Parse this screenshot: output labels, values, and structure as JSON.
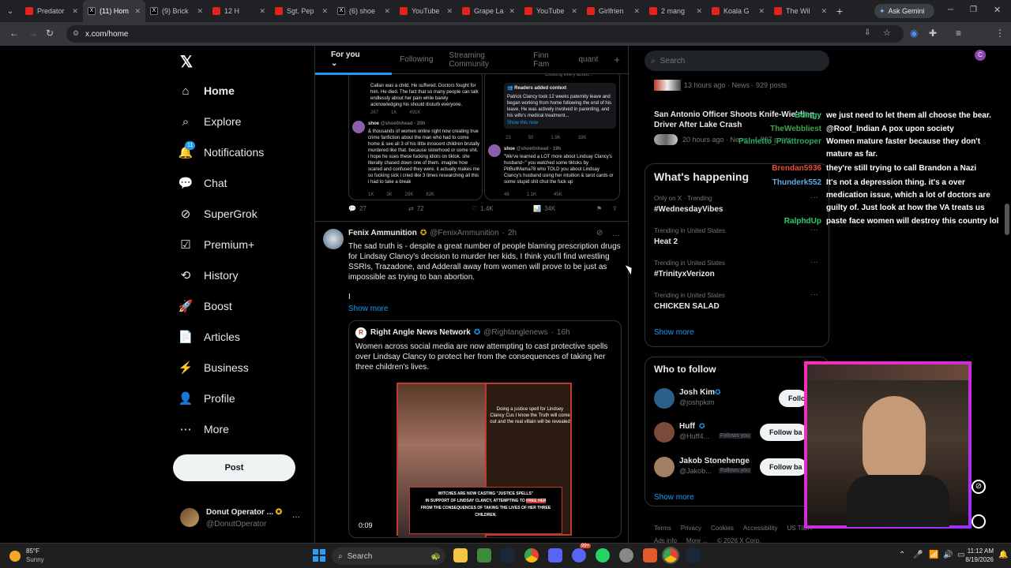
{
  "browser": {
    "tabs": [
      {
        "title": "Predator",
        "icon": "yt"
      },
      {
        "title": "(11) Hom",
        "icon": "x",
        "active": true
      },
      {
        "title": "(9) Brick",
        "icon": "x"
      },
      {
        "title": "12 H",
        "icon": "yt"
      },
      {
        "title": "Sgt. Pep",
        "icon": "yt"
      },
      {
        "title": "(6) shoe",
        "icon": "x"
      },
      {
        "title": "YouTube",
        "icon": "yt"
      },
      {
        "title": "Grape La",
        "icon": "yt"
      },
      {
        "title": "YouTube",
        "icon": "yt"
      },
      {
        "title": "Girlfrien",
        "icon": "yt"
      },
      {
        "title": "2 mang",
        "icon": "yt"
      },
      {
        "title": "Koala G",
        "icon": "yt"
      },
      {
        "title": "The Wil",
        "icon": "yt"
      }
    ],
    "ask_gemini": "Ask Gemini",
    "url": "x.com/home",
    "profile_initial": "C"
  },
  "nav": {
    "items": [
      "Home",
      "Explore",
      "Notifications",
      "Chat",
      "SuperGrok",
      "Premium+",
      "History",
      "Boost",
      "Articles",
      "Business",
      "Profile",
      "More"
    ],
    "notif_badge": "11",
    "post_button": "Post",
    "account_name": "Donut Operator ...",
    "account_handle": "@DonutOperator"
  },
  "feed": {
    "tabs": [
      "For you",
      "Following",
      "Streaming Community",
      "Finn Fam",
      "quant"
    ],
    "prev_left_text": "Callan was a child. He suffered. Doctors fought for him. He died. The fact that so many people can talk endlessly about her pain while barely acknowledging his should disturb everyone.",
    "prev_left_stats": [
      "267",
      "1K",
      "491K"
    ],
    "prev_left_user": "shoe",
    "prev_left_handle": "@shoe0nhead · 20h",
    "prev_left_body": "& thousands of women online right now creating true crime fanfiction about the man who had to come home & see all 3 of his little innocent children brutally murdered like that. because sisterhood or some shit. i hope he sues these fucking idiots on tiktok. she literally chased down one of them. imagine how scared and confused they were. it actually makes me so fucking sick i cried like 3 times researching all this i had to take a break",
    "prev_left_stats2": [
      "1K",
      "3K",
      "29K",
      "82K"
    ],
    "prev_right_top": "Cooking every about...",
    "readers_title": "Readers added context",
    "readers_body": "Patrick Clancy took 12 weeks paternity leave and began working from home following the end of his leave. He was actively involved in parenting, and his wife's medical treatment...",
    "readers_link": "Show this note",
    "prev_right_stats": [
      "23",
      "50",
      "1.9K",
      "33K"
    ],
    "prev_right_user": "shoe",
    "prev_right_handle": "@shoe0nhead · 19h",
    "prev_right_body": "\"We've learned a LOT more about Lindsay Clancy's husband~\" you watched some tiktoks by PitBullMama78 who TOLD you about Lindsay Clancy's husband using her intuition & tarot cards or some stupid shit chut the fuck up",
    "prev_right_stats2": [
      "48",
      "1.1K",
      "45K"
    ],
    "prev_actions": [
      "27",
      "72",
      "1.4K",
      "34K"
    ],
    "post": {
      "name": "Fenix Ammunition",
      "handle": "@FenixAmmunition",
      "time": "2h",
      "text": "The sad truth is - despite a great number of people blaming prescription drugs for Lindsay Clancy's decision to murder her kids, I think you'll find wrestling SSRIs, Trazadone, and Adderall away from women will prove to be just as impossible as trying to ban abortion.",
      "cursor_char": "I",
      "show_more": "Show more",
      "quote_name": "Right Angle News Network",
      "quote_handle": "@Rightanglenews",
      "quote_time": "16h",
      "quote_text": "Women across social media are now attempting to cast protective spells over Lindsay Clancy to protect her from the consequences of taking her three children's lives.",
      "img_caption": "Doing a justice spell for Lindsey Clancy Cus I know the Truth will come out and the real villain will be revealed",
      "img_banner_1": "WITCHES ARE NOW CASTING \"JUSTICE SPELLS\"",
      "img_banner_2": "IN SUPPORT OF LINDSAY CLANCY, ATTEMPTING TO",
      "img_banner_free": "FREE HER",
      "img_banner_3": "FROM THE CONSEQUENCES OF TAKING THE LIVES OF HER THREE CHILDREN.",
      "video_time": "0:09"
    }
  },
  "sidebar": {
    "search_placeholder": "Search",
    "news1_meta": "13 hours ago · News · 929 posts",
    "news2_title": "San Antonio Officer Shoots Knife-Wielding Driver After Lake Crash",
    "news2_meta": "20 hours ago · News · 1,897 posts",
    "whats_happening": "What's happening",
    "trends": [
      {
        "meta": "Only on X · Trending",
        "name": "#WednesdayVibes"
      },
      {
        "meta": "Trending in United States",
        "name": "Heat 2"
      },
      {
        "meta": "Trending in United States",
        "name": "#TrinityxVerizon"
      },
      {
        "meta": "Trending in United States",
        "name": "CHICKEN SALAD"
      }
    ],
    "show_more": "Show more",
    "who_to_follow": "Who to follow",
    "follows": [
      {
        "name": "Josh Kim",
        "handle": "@joshpkim",
        "btn": "Follo",
        "follows_you": ""
      },
      {
        "name": "Huff",
        "handle": "@Huff4...",
        "btn": "Follow ba",
        "follows_you": "Follows you"
      },
      {
        "name": "Jakob Stonehenge",
        "handle": "@Jakob...",
        "btn": "Follow ba",
        "follows_you": "Follows you"
      }
    ],
    "show_more2": "Show more",
    "footer": [
      "Terms",
      "Privacy",
      "Cookies",
      "Accessibility",
      "US TIDA",
      "Ads info",
      "More ...",
      "© 2026 X Corp."
    ]
  },
  "stream_chat": [
    {
      "user": "Bdingy",
      "color": "#2ecc71",
      "text": "we just need to let them all choose the bear."
    },
    {
      "user": "TheWebbliest",
      "color": "#3fa34d",
      "text": "@Roof_Indian A pox upon society"
    },
    {
      "user": "Palmetto_Pirattrooper",
      "color": "#27ae60",
      "text": "Women mature faster because they don't mature as far."
    },
    {
      "user": "Brendan5936",
      "color": "#e74c3c",
      "text": "they're still trying to call Brandon a Nazi"
    },
    {
      "user": "Thunderk552",
      "color": "#5dade2",
      "text": "It's not a depression thing. it's a over medication issue, which a lot of doctors are guilty of. Just look at how the VA treats us"
    },
    {
      "user": "RalphdUp",
      "color": "#2ecc71",
      "text": "paste face women will destroy this country lol"
    }
  ],
  "taskbar": {
    "temp": "85°F",
    "weather": "Sunny",
    "search": "Search",
    "time": "11:12 AM",
    "date": "8/19/2026",
    "badge": "99+"
  }
}
